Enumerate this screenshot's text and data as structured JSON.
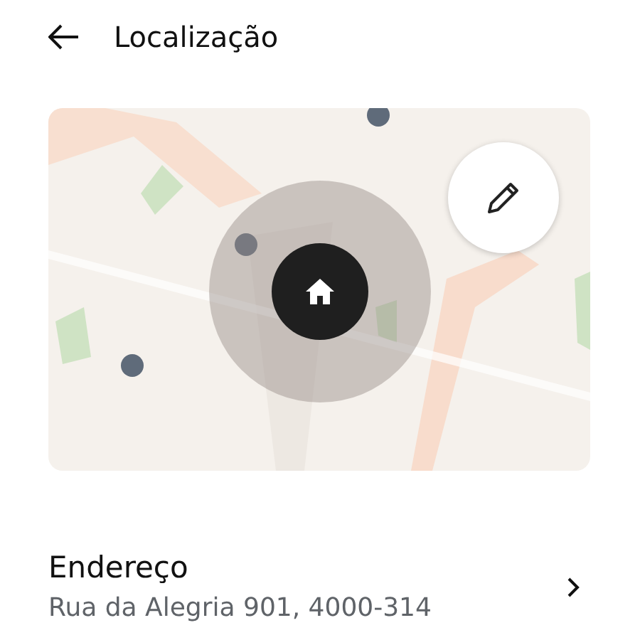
{
  "header": {
    "title": "Localização"
  },
  "address": {
    "label": "Endereço",
    "value": "Rua da Alegria 901, 4000-314"
  }
}
